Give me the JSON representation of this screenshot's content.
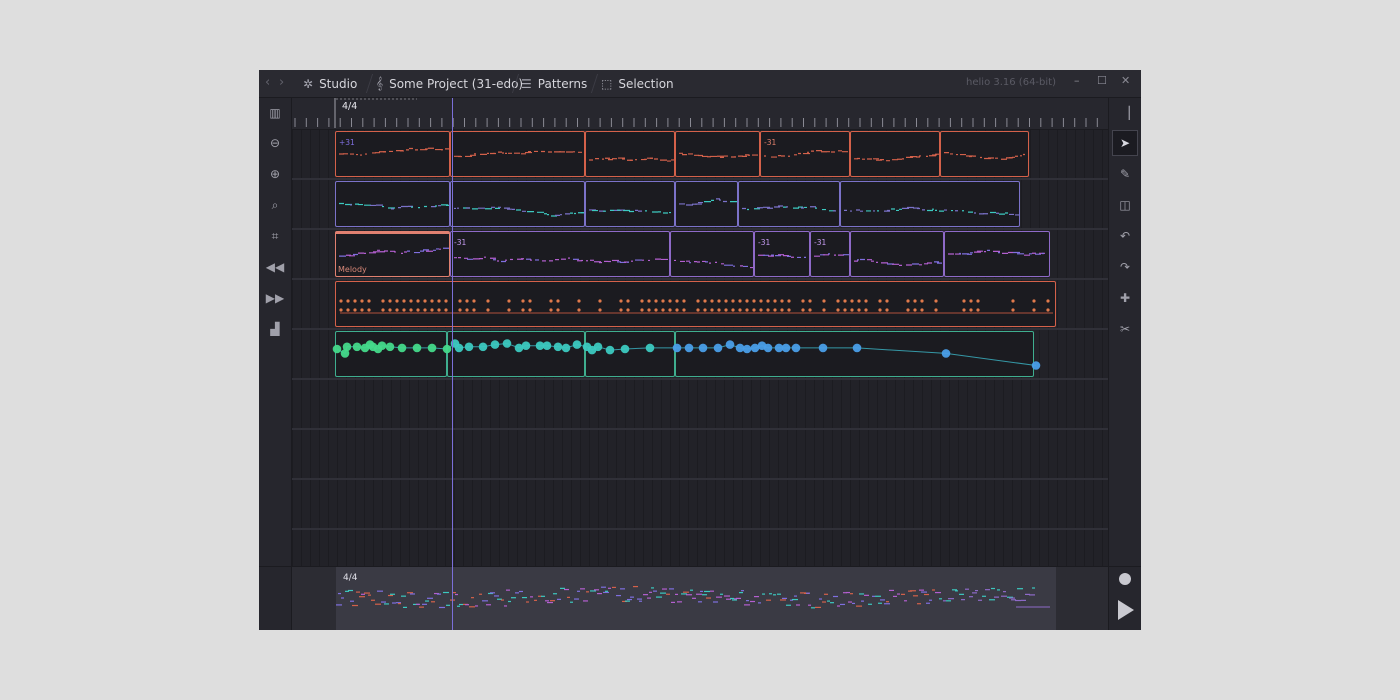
{
  "window": {
    "version": "helio 3.16 (64-bit)",
    "controls": {
      "minimize": "–",
      "maximize": "☐",
      "close": "✕"
    }
  },
  "tabs": [
    {
      "label": "Studio",
      "icon": "gear-icon"
    },
    {
      "label": "Some Project (31-edo)",
      "icon": "treble-clef-icon"
    },
    {
      "label": "Patterns",
      "icon": "patterns-icon"
    },
    {
      "label": "Selection",
      "icon": "selection-icon"
    }
  ],
  "nav": {
    "back": "‹",
    "forward": "›"
  },
  "timeline": {
    "time_signature": "4/4"
  },
  "left_toolbar": [
    {
      "name": "piano-roll-icon",
      "glyph": "▥"
    },
    {
      "name": "zoom-out-icon",
      "glyph": "⊖"
    },
    {
      "name": "zoom-in-icon",
      "glyph": "⊕"
    },
    {
      "name": "zoom-tool-icon",
      "glyph": "⌕"
    },
    {
      "name": "zoom-fit-icon",
      "glyph": "⌗"
    },
    {
      "name": "rewind-icon",
      "glyph": "◀◀"
    },
    {
      "name": "fast-forward-icon",
      "glyph": "▶▶"
    },
    {
      "name": "level-meter-icon",
      "glyph": "▟"
    }
  ],
  "right_toolbar": [
    {
      "name": "panel-toggle-icon",
      "glyph": "▕"
    },
    {
      "name": "cursor-icon",
      "glyph": "➤"
    },
    {
      "name": "pen-icon",
      "glyph": "✎"
    },
    {
      "name": "split-icon",
      "glyph": "◫"
    },
    {
      "name": "undo-icon",
      "glyph": "↶"
    },
    {
      "name": "redo-icon",
      "glyph": "↷"
    },
    {
      "name": "add-icon",
      "glyph": "✚"
    },
    {
      "name": "cut-icon",
      "glyph": "✂"
    }
  ],
  "tracks": [
    {
      "color": "#d4614a",
      "clips": [
        {
          "start": 43,
          "end": 158,
          "tag": "+31",
          "tag_color": "#7f6fe0"
        },
        {
          "start": 158,
          "end": 293
        },
        {
          "start": 293,
          "end": 383
        },
        {
          "start": 383,
          "end": 468
        },
        {
          "start": 468,
          "end": 558,
          "tag": "-31",
          "tag_color": "#e0806c"
        },
        {
          "start": 558,
          "end": 648
        },
        {
          "start": 648,
          "end": 737
        }
      ]
    },
    {
      "color": "#7b72c9",
      "clips": [
        {
          "start": 43,
          "end": 158
        },
        {
          "start": 158,
          "end": 293
        },
        {
          "start": 293,
          "end": 383
        },
        {
          "start": 383,
          "end": 446
        },
        {
          "start": 446,
          "end": 548
        },
        {
          "start": 548,
          "end": 728
        }
      ]
    },
    {
      "color": "#8e6ac8",
      "clips": [
        {
          "start": 43,
          "end": 158,
          "label": "Melody",
          "selected": true
        },
        {
          "start": 158,
          "end": 378,
          "tag": "-31",
          "tag_color": "#c49bf0"
        },
        {
          "start": 378,
          "end": 462
        },
        {
          "start": 462,
          "end": 518,
          "tag": "-31",
          "tag_color": "#c49bf0"
        },
        {
          "start": 518,
          "end": 558,
          "tag": "-31",
          "tag_color": "#c49bf0"
        },
        {
          "start": 558,
          "end": 652
        },
        {
          "start": 652,
          "end": 758
        }
      ]
    },
    {
      "color": "#d4614a",
      "clips": [
        {
          "start": 43,
          "end": 764,
          "drums": true
        }
      ]
    },
    {
      "color": "#3fae8f",
      "clips": [
        {
          "start": 43,
          "end": 155,
          "auto": true
        },
        {
          "start": 155,
          "end": 293,
          "auto": true
        },
        {
          "start": 293,
          "end": 383,
          "auto": true
        },
        {
          "start": 383,
          "end": 742,
          "auto": true
        }
      ]
    }
  ],
  "empty_lanes": 4,
  "automation_points": [
    [
      2,
      10,
      "#44d98a"
    ],
    [
      10,
      14,
      "#44d98a"
    ],
    [
      12,
      8,
      "#44d98a"
    ],
    [
      22,
      8,
      "#44d98a"
    ],
    [
      30,
      9,
      "#44d98a"
    ],
    [
      35,
      6,
      "#44d98a"
    ],
    [
      38,
      8,
      "#44d98a"
    ],
    [
      43,
      10,
      "#44d98a"
    ],
    [
      47,
      7,
      "#44d98a"
    ],
    [
      55,
      8,
      "#44d98a"
    ],
    [
      67,
      9,
      "#44d98a"
    ],
    [
      82,
      9,
      "#44d98a"
    ],
    [
      97,
      9,
      "#44d98a"
    ],
    [
      112,
      10,
      "#44d98a"
    ],
    [
      120,
      5,
      "#3cc9c0"
    ],
    [
      124,
      9,
      "#3cc9c0"
    ],
    [
      134,
      8,
      "#3cc9c0"
    ],
    [
      148,
      8,
      "#3cc9c0"
    ],
    [
      160,
      6,
      "#3cc9c0"
    ],
    [
      172,
      5,
      "#3cc9c0"
    ],
    [
      184,
      9,
      "#3cc9c0"
    ],
    [
      191,
      7,
      "#3cc9c0"
    ],
    [
      205,
      7,
      "#3cc9c0"
    ],
    [
      212,
      7,
      "#3cc9c0"
    ],
    [
      223,
      8,
      "#3cc9c0"
    ],
    [
      231,
      9,
      "#3cc9c0"
    ],
    [
      242,
      6,
      "#3cc9c0"
    ],
    [
      252,
      8,
      "#3cc9c0"
    ],
    [
      257,
      11,
      "#3cc9c0"
    ],
    [
      263,
      8,
      "#3cc9c0"
    ],
    [
      275,
      11,
      "#3cc9c0"
    ],
    [
      290,
      10,
      "#3cc9c0"
    ],
    [
      315,
      9,
      "#3cc9c0"
    ],
    [
      342,
      9,
      "#4a9ee8"
    ],
    [
      354,
      9,
      "#4a9ee8"
    ],
    [
      368,
      9,
      "#4a9ee8"
    ],
    [
      383,
      9,
      "#4a9ee8"
    ],
    [
      395,
      6,
      "#4a9ee8"
    ],
    [
      405,
      9,
      "#4a9ee8"
    ],
    [
      412,
      10,
      "#4a9ee8"
    ],
    [
      420,
      9,
      "#4a9ee8"
    ],
    [
      427,
      7,
      "#4a9ee8"
    ],
    [
      433,
      9,
      "#4a9ee8"
    ],
    [
      444,
      9,
      "#4a9ee8"
    ],
    [
      451,
      9,
      "#4a9ee8"
    ],
    [
      461,
      9,
      "#4a9ee8"
    ],
    [
      488,
      9,
      "#4a9ee8"
    ],
    [
      522,
      9,
      "#4a9ee8"
    ],
    [
      611,
      14,
      "#4a9ee8"
    ],
    [
      701,
      25,
      "#4a9ee8"
    ]
  ]
}
